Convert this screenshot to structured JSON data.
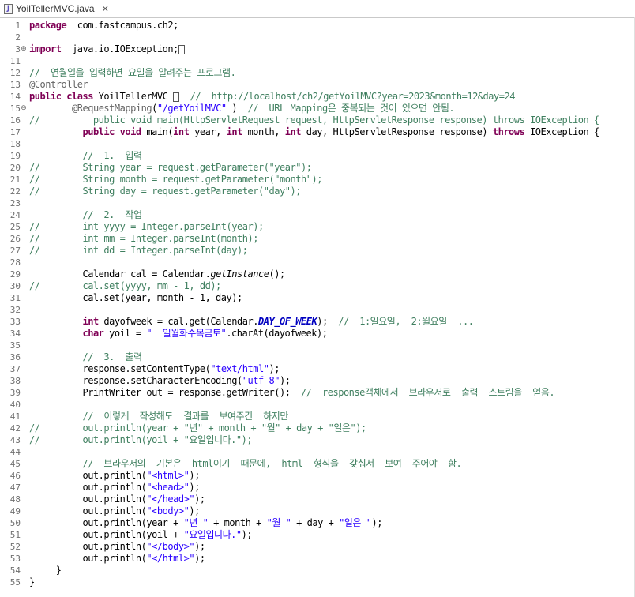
{
  "tab": {
    "icon": "java-file-icon",
    "label": "YoilTellerMVC.java",
    "close": "✕"
  },
  "lines": [
    {
      "n": "1",
      "fold": "",
      "parts": [
        [
          "kw",
          "package"
        ],
        [
          "",
          "  com.fastcampus.ch2;"
        ]
      ]
    },
    {
      "n": "2",
      "fold": "",
      "parts": []
    },
    {
      "n": "3",
      "fold": "⊕",
      "parts": [
        [
          "kw",
          "import"
        ],
        [
          "",
          "  java.io.IOException;"
        ],
        [
          "caret",
          ""
        ]
      ]
    },
    {
      "n": "11",
      "fold": "",
      "parts": []
    },
    {
      "n": "12",
      "fold": "",
      "parts": [
        [
          "cm",
          "//  연월일을 입력하면 요일을 알려주는 프로그램."
        ]
      ]
    },
    {
      "n": "13",
      "fold": "",
      "parts": [
        [
          "ann",
          "@Controller"
        ]
      ]
    },
    {
      "n": "14",
      "fold": "",
      "parts": [
        [
          "kw",
          "public class"
        ],
        [
          "",
          " YoilTellerMVC "
        ],
        [
          "caret",
          ""
        ],
        [
          "",
          " "
        ],
        [
          "cm",
          " //  http://localhost/ch2/getYoilMVC?year=2023&month=12&day=24"
        ]
      ]
    },
    {
      "n": "15",
      "fold": "⊖",
      "parts": [
        [
          "",
          "        "
        ],
        [
          "ann",
          "@RequestMapping"
        ],
        [
          "",
          "("
        ],
        [
          "str",
          "\"/getYoilMVC\""
        ],
        [
          "",
          " )  "
        ],
        [
          "cm",
          "//  URL Mapping은 중복되는 것이 있으면 안됨."
        ]
      ]
    },
    {
      "n": "16",
      "fold": "",
      "parts": [
        [
          "cm",
          "//          public void main(HttpServletRequest request, HttpServletResponse response) throws IOException {"
        ]
      ]
    },
    {
      "n": "17",
      "fold": "",
      "parts": [
        [
          "",
          "          "
        ],
        [
          "kw",
          "public void"
        ],
        [
          "",
          " main("
        ],
        [
          "kw",
          "int"
        ],
        [
          "",
          " year, "
        ],
        [
          "kw",
          "int"
        ],
        [
          "",
          " month, "
        ],
        [
          "kw",
          "int"
        ],
        [
          "",
          " day, HttpServletResponse response) "
        ],
        [
          "kw",
          "throws"
        ],
        [
          "",
          " IOException {"
        ]
      ]
    },
    {
      "n": "18",
      "fold": "",
      "parts": []
    },
    {
      "n": "19",
      "fold": "",
      "parts": [
        [
          "",
          "          "
        ],
        [
          "cm",
          "//  1.  입력"
        ]
      ]
    },
    {
      "n": "20",
      "fold": "",
      "parts": [
        [
          "cm",
          "//        String year = request.getParameter(\"year\");"
        ]
      ]
    },
    {
      "n": "21",
      "fold": "",
      "parts": [
        [
          "cm",
          "//        String month = request.getParameter(\"month\");"
        ]
      ]
    },
    {
      "n": "22",
      "fold": "",
      "parts": [
        [
          "cm",
          "//        String day = request.getParameter(\"day\");"
        ]
      ]
    },
    {
      "n": "23",
      "fold": "",
      "parts": []
    },
    {
      "n": "24",
      "fold": "",
      "parts": [
        [
          "",
          "          "
        ],
        [
          "cm",
          "//  2.  작업"
        ]
      ]
    },
    {
      "n": "25",
      "fold": "",
      "parts": [
        [
          "cm",
          "//        int yyyy = Integer.parseInt(year);"
        ]
      ]
    },
    {
      "n": "26",
      "fold": "",
      "parts": [
        [
          "cm",
          "//        int mm = Integer.parseInt(month);"
        ]
      ]
    },
    {
      "n": "27",
      "fold": "",
      "parts": [
        [
          "cm",
          "//        int dd = Integer.parseInt(day);"
        ]
      ]
    },
    {
      "n": "28",
      "fold": "",
      "parts": []
    },
    {
      "n": "29",
      "fold": "",
      "parts": [
        [
          "",
          "          Calendar cal = Calendar."
        ],
        [
          "it",
          "getInstance"
        ],
        [
          "",
          "();"
        ]
      ]
    },
    {
      "n": "30",
      "fold": "",
      "parts": [
        [
          "cm",
          "//        cal.set(yyyy, mm - 1, dd);"
        ]
      ]
    },
    {
      "n": "31",
      "fold": "",
      "parts": [
        [
          "",
          "          cal.set(year, month - 1, day);"
        ]
      ]
    },
    {
      "n": "32",
      "fold": "",
      "parts": []
    },
    {
      "n": "33",
      "fold": "",
      "parts": [
        [
          "",
          "          "
        ],
        [
          "kw",
          "int"
        ],
        [
          "",
          " dayofweek = cal.get(Calendar."
        ],
        [
          "fld",
          "DAY_OF_WEEK"
        ],
        [
          "",
          ");  "
        ],
        [
          "cm",
          "//  1:일요일,  2:월요일  ..."
        ]
      ]
    },
    {
      "n": "34",
      "fold": "",
      "parts": [
        [
          "",
          "          "
        ],
        [
          "kw",
          "char"
        ],
        [
          "",
          " yoil = "
        ],
        [
          "str",
          "\"  일월화수목금토\""
        ],
        [
          "",
          ".charAt(dayofweek);"
        ]
      ]
    },
    {
      "n": "35",
      "fold": "",
      "parts": []
    },
    {
      "n": "36",
      "fold": "",
      "parts": [
        [
          "",
          "          "
        ],
        [
          "cm",
          "//  3.  출력"
        ]
      ]
    },
    {
      "n": "37",
      "fold": "",
      "parts": [
        [
          "",
          "          response.setContentType("
        ],
        [
          "str",
          "\"text/html\""
        ],
        [
          "",
          ");"
        ]
      ]
    },
    {
      "n": "38",
      "fold": "",
      "parts": [
        [
          "",
          "          response.setCharacterEncoding("
        ],
        [
          "str",
          "\"utf-8\""
        ],
        [
          "",
          ");"
        ]
      ]
    },
    {
      "n": "39",
      "fold": "",
      "parts": [
        [
          "",
          "          PrintWriter out = response.getWriter();  "
        ],
        [
          "cm",
          "//  response객체에서  브라우저로  출력  스트림을  얻음."
        ]
      ]
    },
    {
      "n": "40",
      "fold": "",
      "parts": []
    },
    {
      "n": "41",
      "fold": "",
      "parts": [
        [
          "",
          "          "
        ],
        [
          "cm",
          "//  이렇게  작성해도  결과를  보여주긴  하지만"
        ]
      ]
    },
    {
      "n": "42",
      "fold": "",
      "parts": [
        [
          "cm",
          "//        out.println(year + \"년\" + month + \"월\" + day + \"일은\");"
        ]
      ]
    },
    {
      "n": "43",
      "fold": "",
      "parts": [
        [
          "cm",
          "//        out.println(yoil + \"요일입니다.\");"
        ]
      ]
    },
    {
      "n": "44",
      "fold": "",
      "parts": []
    },
    {
      "n": "45",
      "fold": "",
      "parts": [
        [
          "",
          "          "
        ],
        [
          "cm",
          "//  브라우저의  기본은  html이기  때문에,  html  형식을  갖춰서  보여  주어야  함."
        ]
      ]
    },
    {
      "n": "46",
      "fold": "",
      "parts": [
        [
          "",
          "          out.println("
        ],
        [
          "str",
          "\"<html>\""
        ],
        [
          "",
          ");"
        ]
      ]
    },
    {
      "n": "47",
      "fold": "",
      "parts": [
        [
          "",
          "          out.println("
        ],
        [
          "str",
          "\"<head>\""
        ],
        [
          "",
          ");"
        ]
      ]
    },
    {
      "n": "48",
      "fold": "",
      "parts": [
        [
          "",
          "          out.println("
        ],
        [
          "str",
          "\"</head>\""
        ],
        [
          "",
          ");"
        ]
      ]
    },
    {
      "n": "49",
      "fold": "",
      "parts": [
        [
          "",
          "          out.println("
        ],
        [
          "str",
          "\"<body>\""
        ],
        [
          "",
          ");"
        ]
      ]
    },
    {
      "n": "50",
      "fold": "",
      "parts": [
        [
          "",
          "          out.println(year + "
        ],
        [
          "str",
          "\"년 \""
        ],
        [
          "",
          " + month + "
        ],
        [
          "str",
          "\"월 \""
        ],
        [
          "",
          " + day + "
        ],
        [
          "str",
          "\"일은 \""
        ],
        [
          "",
          ");"
        ]
      ]
    },
    {
      "n": "51",
      "fold": "",
      "parts": [
        [
          "",
          "          out.println(yoil + "
        ],
        [
          "str",
          "\"요일입니다.\""
        ],
        [
          "",
          ");"
        ]
      ]
    },
    {
      "n": "52",
      "fold": "",
      "parts": [
        [
          "",
          "          out.println("
        ],
        [
          "str",
          "\"</body>\""
        ],
        [
          "",
          ");"
        ]
      ]
    },
    {
      "n": "53",
      "fold": "",
      "parts": [
        [
          "",
          "          out.println("
        ],
        [
          "str",
          "\"</html>\""
        ],
        [
          "",
          ");"
        ]
      ]
    },
    {
      "n": "54",
      "fold": "",
      "parts": [
        [
          "",
          "     }"
        ]
      ]
    },
    {
      "n": "55",
      "fold": "",
      "parts": [
        [
          "",
          "}"
        ]
      ]
    }
  ]
}
